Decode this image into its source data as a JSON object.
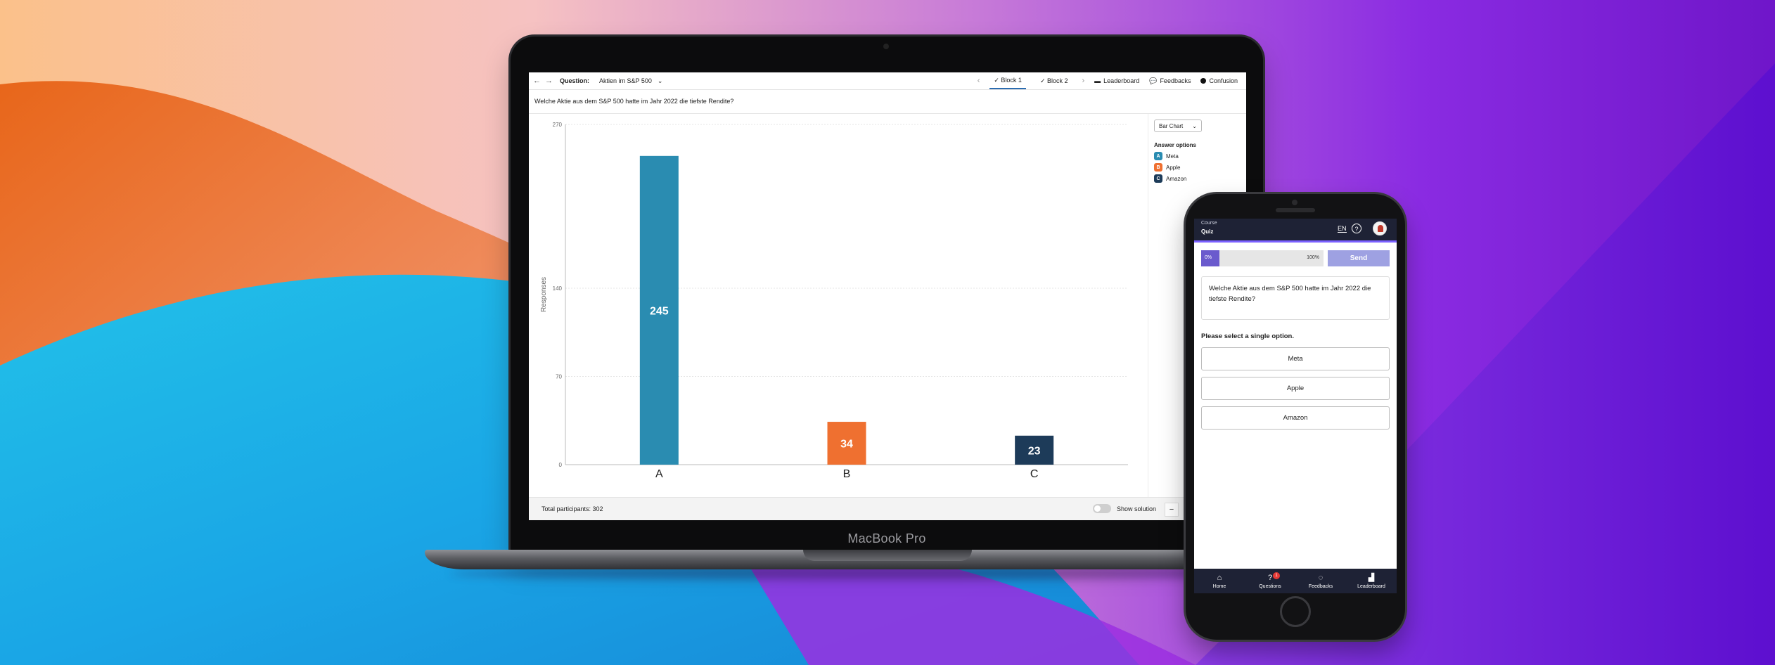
{
  "colors": {
    "option_a": "#2a8cb1",
    "option_b": "#ef7030",
    "option_c": "#1d3b59",
    "phone_header": "#1e2235",
    "progress_fill": "#6a5acd",
    "send_button": "#9ea1e2"
  },
  "laptop": {
    "label": "MacBook Pro",
    "topbar": {
      "question_label": "Question:",
      "question_value": "Aktien im S&P 500",
      "tabs": [
        "Block 1",
        "Block 2"
      ],
      "active_tab": "Block 1",
      "leaderboard": "Leaderboard",
      "feedbacks": "Feedbacks",
      "confusion": "Confusion"
    },
    "question_text": "Welche Aktie aus dem S&P 500 hatte im Jahr 2022 die tiefste Rendite?",
    "chart_type_select": "Bar Chart",
    "answer_options_title": "Answer options",
    "answer_options": [
      {
        "letter": "A",
        "label": "Meta"
      },
      {
        "letter": "B",
        "label": "Apple"
      },
      {
        "letter": "C",
        "label": "Amazon"
      }
    ],
    "footer": {
      "participants": "Total participants: 302",
      "show_solution": "Show solution",
      "zoom_out": "−"
    }
  },
  "chart_data": {
    "type": "bar",
    "categories": [
      "A",
      "B",
      "C"
    ],
    "values": [
      245,
      34,
      23
    ],
    "ylabel": "Responses",
    "ylim": [
      0,
      270
    ],
    "yticks": [
      0,
      70,
      140,
      270
    ],
    "grid": true
  },
  "phone": {
    "header_small": "Course",
    "header_title": "Quiz",
    "language": "EN",
    "help": "?",
    "progress_left": "0%",
    "progress_right": "100%",
    "progress_value": 0,
    "send_label": "Send",
    "question_text": "Welche Aktie aus dem S&P 500 hatte im Jahr 2022 die tiefste Rendite?",
    "instruction": "Please select a single option.",
    "options": [
      "Meta",
      "Apple",
      "Amazon"
    ],
    "tabs": [
      {
        "label": "Home",
        "icon": "home-icon"
      },
      {
        "label": "Questions",
        "icon": "question-icon",
        "badge": "1"
      },
      {
        "label": "Feedbacks",
        "icon": "chat-bubble-icon"
      },
      {
        "label": "Leaderboard",
        "icon": "podium-icon"
      }
    ]
  }
}
